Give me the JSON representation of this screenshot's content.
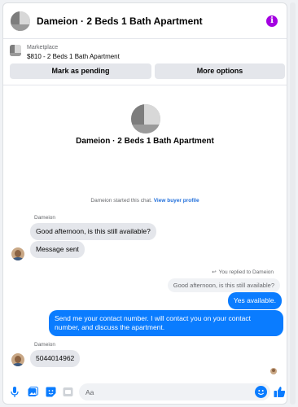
{
  "header": {
    "title": "Dameion · 2 Beds 1 Bath Apartment",
    "info_icon": "info-icon"
  },
  "marketplace": {
    "label": "Marketplace",
    "item": "$810 - 2 Beds 1 Bath Apartment",
    "buttons": {
      "pending": "Mark as pending",
      "more": "More options"
    }
  },
  "conversation": {
    "title": "Dameion · 2 Beds 1 Bath Apartment",
    "started_text": "Dameion started this chat.",
    "profile_link": "View buyer profile",
    "messages": [
      {
        "sender": "Dameion",
        "text": "Good afternoon, is this still available?"
      },
      {
        "text": "Message sent"
      },
      {
        "reply_note": "You replied to Dameion",
        "quoted": "Good afternoon, is this still available?",
        "text": "Yes available."
      },
      {
        "text": "Send me your contact number. I will contact you on your contact number, and discuss the apartment."
      },
      {
        "sender": "Dameion",
        "text": "5044014962"
      }
    ]
  },
  "composer": {
    "placeholder": "Aa",
    "accent": "#0a7cff"
  }
}
